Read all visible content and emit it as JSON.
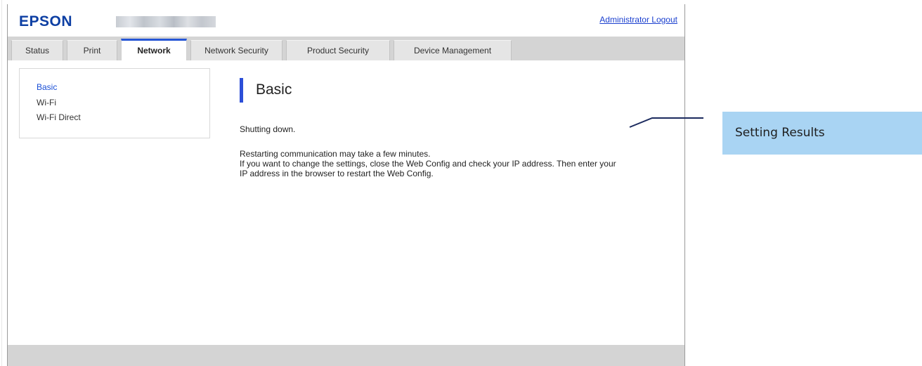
{
  "header": {
    "logo": "EPSON",
    "logout_label": "Administrator Logout"
  },
  "tabs": [
    {
      "label": "Status",
      "active": false
    },
    {
      "label": "Print",
      "active": false
    },
    {
      "label": "Network",
      "active": true
    },
    {
      "label": "Network Security",
      "active": false
    },
    {
      "label": "Product Security",
      "active": false
    },
    {
      "label": "Device Management",
      "active": false
    }
  ],
  "sidebar": {
    "items": [
      {
        "label": "Basic",
        "active": true
      },
      {
        "label": "Wi-Fi",
        "active": false
      },
      {
        "label": "Wi-Fi Direct",
        "active": false
      }
    ]
  },
  "main": {
    "title": "Basic",
    "message_status": "Shutting down.",
    "message_lines": [
      "Restarting communication may take a few minutes.",
      "If you want to change the settings, close the Web Config and check your IP address. Then enter your",
      "IP address in the browser to restart the Web Config."
    ]
  },
  "callout": {
    "label": "Setting Results"
  },
  "colors": {
    "brand": "#0d3fa3",
    "accent": "#2c4fd8",
    "link": "#1a3fcf",
    "callout_bg": "#a9d4f3"
  }
}
